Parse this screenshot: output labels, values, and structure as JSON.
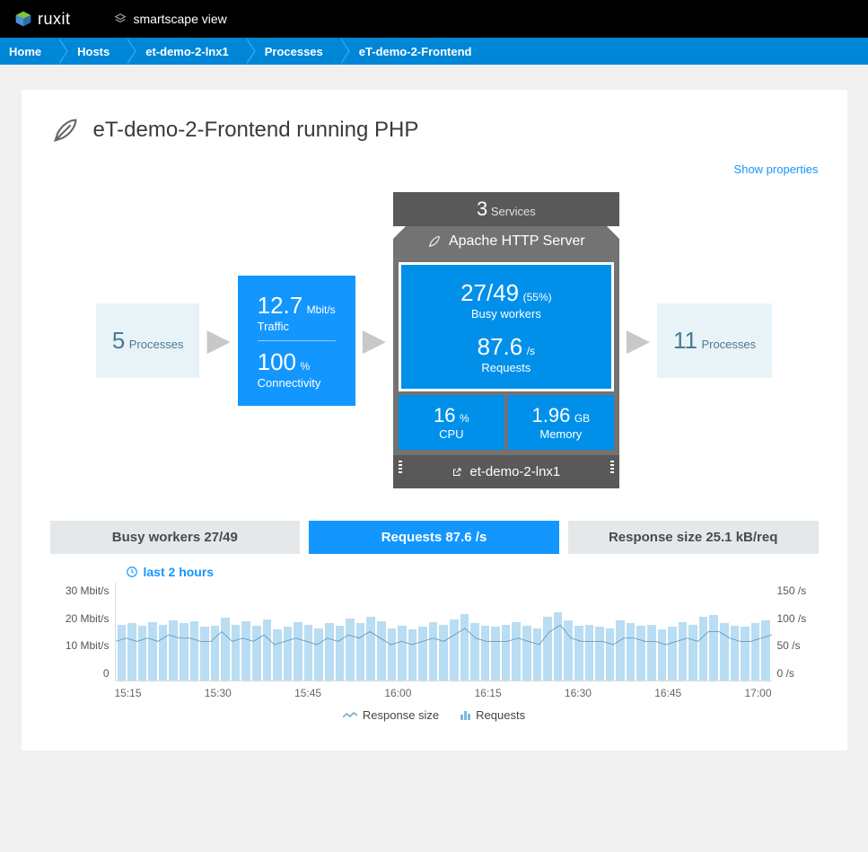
{
  "brand": "ruxit",
  "header_link": "smartscape view",
  "breadcrumbs": [
    "Home",
    "Hosts",
    "et-demo-2-lnx1",
    "Processes",
    "eT-demo-2-Frontend"
  ],
  "page_title": "eT-demo-2-Frontend running PHP",
  "show_properties": "Show properties",
  "left_box": {
    "num": "5",
    "label": "Processes"
  },
  "traffic_box": {
    "v1": "12.7",
    "u1": "Mbit/s",
    "l1": "Traffic",
    "v2": "100",
    "u2": "%",
    "l2": "Connectivity"
  },
  "apache": {
    "services_n": "3",
    "services_l": "Services",
    "title": "Apache HTTP Server",
    "busy_v": "27/49",
    "busy_pct": "(55%)",
    "busy_l": "Busy workers",
    "req_v": "87.6",
    "req_u": "/s",
    "req_l": "Requests",
    "cpu_v": "16",
    "cpu_u": "%",
    "cpu_l": "CPU",
    "mem_v": "1.96",
    "mem_u": "GB",
    "mem_l": "Memory",
    "host": "et-demo-2-lnx1"
  },
  "right_box": {
    "num": "11",
    "label": "Processes"
  },
  "tabs": [
    {
      "label": "Busy workers 27/49",
      "active": false
    },
    {
      "label": "Requests 87.6 /s",
      "active": true
    },
    {
      "label": "Response size 25.1 kB/req",
      "active": false
    }
  ],
  "time_label": "last 2 hours",
  "y_left": [
    "30 Mbit/s",
    "20 Mbit/s",
    "10 Mbit/s",
    "0"
  ],
  "y_right": [
    "150 /s",
    "100 /s",
    "50 /s",
    "0 /s"
  ],
  "x_ticks": [
    "15:15",
    "15:30",
    "15:45",
    "16:00",
    "16:15",
    "16:30",
    "16:45",
    "17:00"
  ],
  "legend": {
    "a": "Response size",
    "b": "Requests"
  },
  "chart_data": {
    "type": "bar+line",
    "x_interval_minutes": 2,
    "series": [
      {
        "name": "Requests",
        "type": "bar",
        "unit": "/s",
        "axis": "right",
        "values": [
          85,
          88,
          84,
          90,
          86,
          92,
          88,
          91,
          82,
          84,
          97,
          86,
          91,
          84,
          93,
          78,
          82,
          90,
          86,
          80,
          88,
          84,
          95,
          88,
          98,
          91,
          80,
          84,
          78,
          82,
          89,
          86,
          94,
          102,
          88,
          84,
          82,
          86,
          90,
          84,
          80,
          98,
          105,
          92,
          84,
          86,
          82,
          80,
          92,
          88,
          84,
          86,
          78,
          82,
          90,
          86,
          98,
          100,
          88,
          84,
          82,
          88,
          92
        ]
      },
      {
        "name": "Response size",
        "type": "line",
        "unit": "Mbit/s",
        "axis": "left",
        "values": [
          12,
          13,
          12,
          13,
          12,
          14,
          13,
          13,
          12,
          12,
          15,
          12,
          13,
          12,
          14,
          11,
          12,
          13,
          12,
          11,
          13,
          12,
          14,
          13,
          15,
          13,
          11,
          12,
          11,
          12,
          13,
          12,
          14,
          16,
          13,
          12,
          12,
          12,
          13,
          12,
          11,
          15,
          17,
          13,
          12,
          12,
          12,
          11,
          13,
          13,
          12,
          12,
          11,
          12,
          13,
          12,
          15,
          15,
          13,
          12,
          12,
          13,
          14
        ]
      }
    ],
    "y_left_range": [
      0,
      30
    ],
    "y_right_range": [
      0,
      150
    ],
    "x_start": "15:05",
    "x_end": "17:10"
  }
}
